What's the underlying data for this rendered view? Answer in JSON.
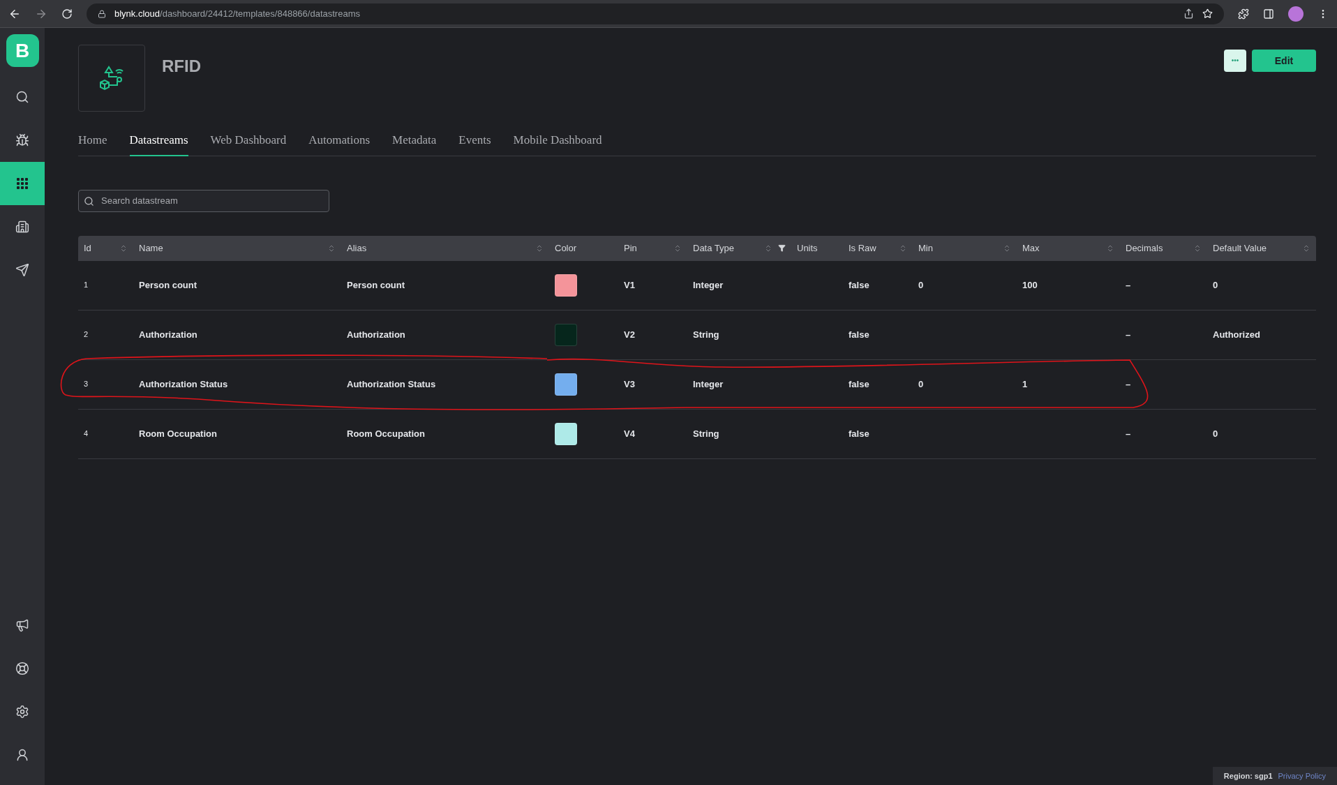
{
  "browser": {
    "host": "blynk.cloud",
    "path": "/dashboard/24412/templates/848866/datastreams"
  },
  "sidebar": {
    "logo": "B",
    "items": [
      {
        "kind": "search",
        "selected": false
      },
      {
        "kind": "bug",
        "selected": false
      },
      {
        "kind": "grid",
        "selected": true
      },
      {
        "kind": "building",
        "selected": false
      },
      {
        "kind": "send",
        "selected": false
      },
      {
        "kind": "megaphone",
        "selected": false
      },
      {
        "kind": "lifebuoy",
        "selected": false
      },
      {
        "kind": "settings",
        "selected": false
      },
      {
        "kind": "user",
        "selected": false
      }
    ]
  },
  "header": {
    "title": "RFID",
    "more_button": "•••",
    "edit_button": "Edit"
  },
  "tabs": [
    {
      "label": "Home",
      "selected": false
    },
    {
      "label": "Datastreams",
      "selected": true
    },
    {
      "label": "Web Dashboard",
      "selected": false
    },
    {
      "label": "Automations",
      "selected": false
    },
    {
      "label": "Metadata",
      "selected": false
    },
    {
      "label": "Events",
      "selected": false
    },
    {
      "label": "Mobile Dashboard",
      "selected": false
    }
  ],
  "search": {
    "placeholder": "Search datastream"
  },
  "table": {
    "columns": [
      {
        "label": "Id",
        "sortable": true,
        "filterable": false
      },
      {
        "label": "Name",
        "sortable": true,
        "filterable": false
      },
      {
        "label": "Alias",
        "sortable": true,
        "filterable": false
      },
      {
        "label": "Color",
        "sortable": false,
        "filterable": false
      },
      {
        "label": "Pin",
        "sortable": true,
        "filterable": false
      },
      {
        "label": "Data Type",
        "sortable": true,
        "filterable": true
      },
      {
        "label": "Units",
        "sortable": false,
        "filterable": false
      },
      {
        "label": "Is Raw",
        "sortable": true,
        "filterable": false
      },
      {
        "label": "Min",
        "sortable": true,
        "filterable": false
      },
      {
        "label": "Max",
        "sortable": true,
        "filterable": false
      },
      {
        "label": "Decimals",
        "sortable": true,
        "filterable": false
      },
      {
        "label": "Default Value",
        "sortable": true,
        "filterable": false
      }
    ],
    "rows": [
      {
        "id": "1",
        "name": "Person count",
        "alias": "Person count",
        "color": "#f4949a",
        "pin": "V1",
        "data_type": "Integer",
        "is_raw": "false",
        "min": "0",
        "max": "100",
        "decimals": "–",
        "default_value": "0"
      },
      {
        "id": "2",
        "name": "Authorization",
        "alias": "Authorization",
        "color": "#06261c",
        "pin": "V2",
        "data_type": "String",
        "is_raw": "false",
        "decimals": "–",
        "default_value": "Authorized"
      },
      {
        "id": "3",
        "name": "Authorization Status",
        "alias": "Authorization Status",
        "color": "#74aeee",
        "pin": "V3",
        "data_type": "Integer",
        "is_raw": "false",
        "min": "0",
        "max": "1",
        "decimals": "–"
      },
      {
        "id": "4",
        "name": "Room Occupation",
        "alias": "Room Occupation",
        "color": "#aeeae8",
        "pin": "V4",
        "data_type": "String",
        "is_raw": "false",
        "decimals": "–",
        "default_value": "0"
      }
    ]
  },
  "footer": {
    "region": "Region: sgp1",
    "link": "Privacy Policy"
  }
}
